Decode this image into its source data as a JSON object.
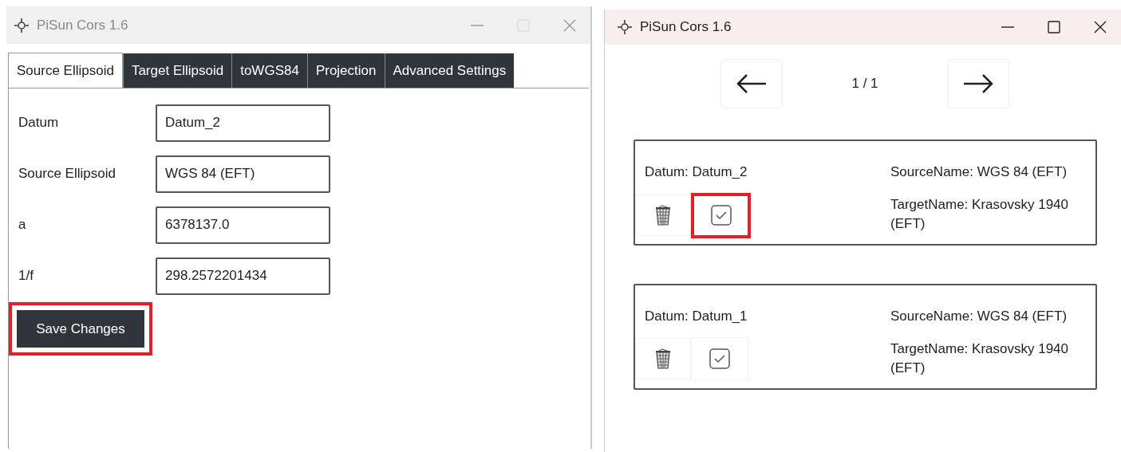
{
  "left_window": {
    "title": "PiSun Cors 1.6",
    "tabs": [
      {
        "label": "Source Ellipsoid",
        "selected": true
      },
      {
        "label": "Target Ellipsoid",
        "selected": false
      },
      {
        "label": "toWGS84",
        "selected": false
      },
      {
        "label": "Projection",
        "selected": false
      },
      {
        "label": "Advanced Settings",
        "selected": false
      }
    ],
    "fields": [
      {
        "label": "Datum",
        "value": "Datum_2"
      },
      {
        "label": "Source Ellipsoid",
        "value": "WGS 84 (EFT)"
      },
      {
        "label": "a",
        "value": "6378137.0"
      },
      {
        "label": "1/f",
        "value": "298.2572201434"
      }
    ],
    "save_button": {
      "label": "Save Changes",
      "highlighted": true
    }
  },
  "right_window": {
    "title": "PiSun Cors 1.6",
    "page": "1 / 1",
    "cards": [
      {
        "datum": "Datum: Datum_2",
        "source": "SourceName: WGS 84 (EFT)",
        "target": "TargetName: Krasovsky 1940 (EFT)",
        "highlighted": true
      },
      {
        "datum": "Datum: Datum_1",
        "source": "SourceName: WGS 84 (EFT)",
        "target": "TargetName: Krasovsky 1940 (EFT)",
        "highlighted": false
      }
    ]
  }
}
